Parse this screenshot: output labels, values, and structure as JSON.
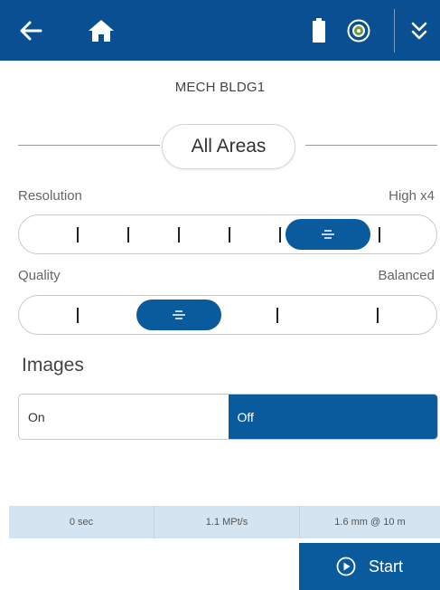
{
  "header": {
    "back_icon": "arrow-left-icon",
    "home_icon": "home-icon",
    "battery_icon": "battery-icon",
    "target_icon": "target-icon",
    "expand_icon": "double-chevron-down-icon",
    "color": "#0a4f92"
  },
  "site": {
    "name": "MECH BLDG1"
  },
  "area": {
    "label": "All Areas"
  },
  "resolution": {
    "label": "Resolution",
    "value": "High x4",
    "steps": 7,
    "selected_step": 6
  },
  "quality": {
    "label": "Quality",
    "value": "Balanced",
    "steps": 4,
    "selected_step": 2
  },
  "images": {
    "title": "Images",
    "options": [
      "On",
      "Off"
    ],
    "selected": "Off"
  },
  "status": {
    "duration": "0 sec",
    "rate": "1.1 MPt/s",
    "point_spacing": "1.6 mm @ 10 m"
  },
  "start": {
    "label": "Start",
    "icon": "play-circle-icon"
  },
  "accent_color": "#0a5a9e"
}
